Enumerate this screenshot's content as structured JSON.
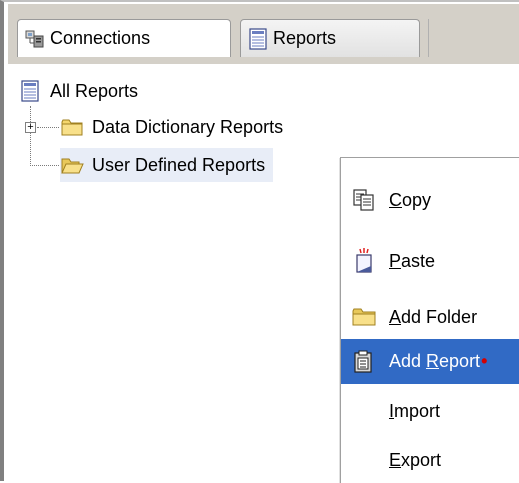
{
  "tabs": [
    {
      "label": "Connections",
      "icon": "connections-icon"
    },
    {
      "label": "Reports",
      "icon": "reports-icon"
    }
  ],
  "tree": {
    "root": {
      "label": "All Reports",
      "icon": "reports-icon"
    },
    "children": [
      {
        "label": "Data Dictionary Reports",
        "icon": "folder-closed-icon",
        "expander": "+"
      },
      {
        "label": "User Defined Reports",
        "icon": "folder-open-icon"
      }
    ]
  },
  "context_menu": {
    "items": [
      {
        "label_pre": "",
        "label_key": "C",
        "label_post": "opy",
        "icon": "copy-icon"
      },
      {
        "label_pre": "",
        "label_key": "P",
        "label_post": "aste",
        "icon": "paste-icon"
      },
      {
        "label_pre": "",
        "label_key": "A",
        "label_post": "dd Folder",
        "icon": "folder-icon"
      },
      {
        "label_pre": "Add ",
        "label_key": "R",
        "label_post": "eport",
        "icon": "add-report-icon",
        "selected": true
      },
      {
        "label_pre": "",
        "label_key": "I",
        "label_post": "mport"
      },
      {
        "label_pre": "",
        "label_key": "E",
        "label_post": "xport"
      }
    ]
  },
  "colors": {
    "selection": "#316ac5",
    "tree_selection": "#e8edf7",
    "folder": "#f5d76e"
  }
}
